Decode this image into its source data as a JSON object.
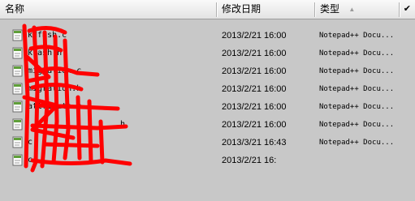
{
  "columns": {
    "name": "名称",
    "modified": "修改日期",
    "type": "类型"
  },
  "icons": {
    "sort": "sort-ascending-icon",
    "check": "checkmark-icon",
    "file": "notepad-file-icon"
  },
  "files": [
    {
      "name": "kdfash.c",
      "date": "2013/2/21 16:00",
      "type": "Notepad++ Docu..."
    },
    {
      "name": "kfash.h",
      "date": "2013/2/21 16:00",
      "type": "Notepad++ Docu..."
    },
    {
      "name": "migration.c",
      "date": "2013/2/21 16:00",
      "type": "Notepad++ Docu..."
    },
    {
      "name": "migration.h",
      "date": "2013/2/21 16:00",
      "type": "Notepad++ Docu..."
    },
    {
      "name": "attribute.c",
      "date": "2013/2/21 16:00",
      "type": "Notepad++ Docu..."
    },
    {
      "name": "h",
      "date": "2013/2/21 16:00",
      "type": "Notepad++ Docu..."
    },
    {
      "name": "c",
      "date": "2013/3/21 16:43",
      "type": "Notepad++ Docu..."
    },
    {
      "name": "c",
      "date": "2013/2/21 16:",
      "type": ""
    }
  ],
  "colors": {
    "background": "#c8c8c8",
    "scribble": "#ff0000"
  }
}
